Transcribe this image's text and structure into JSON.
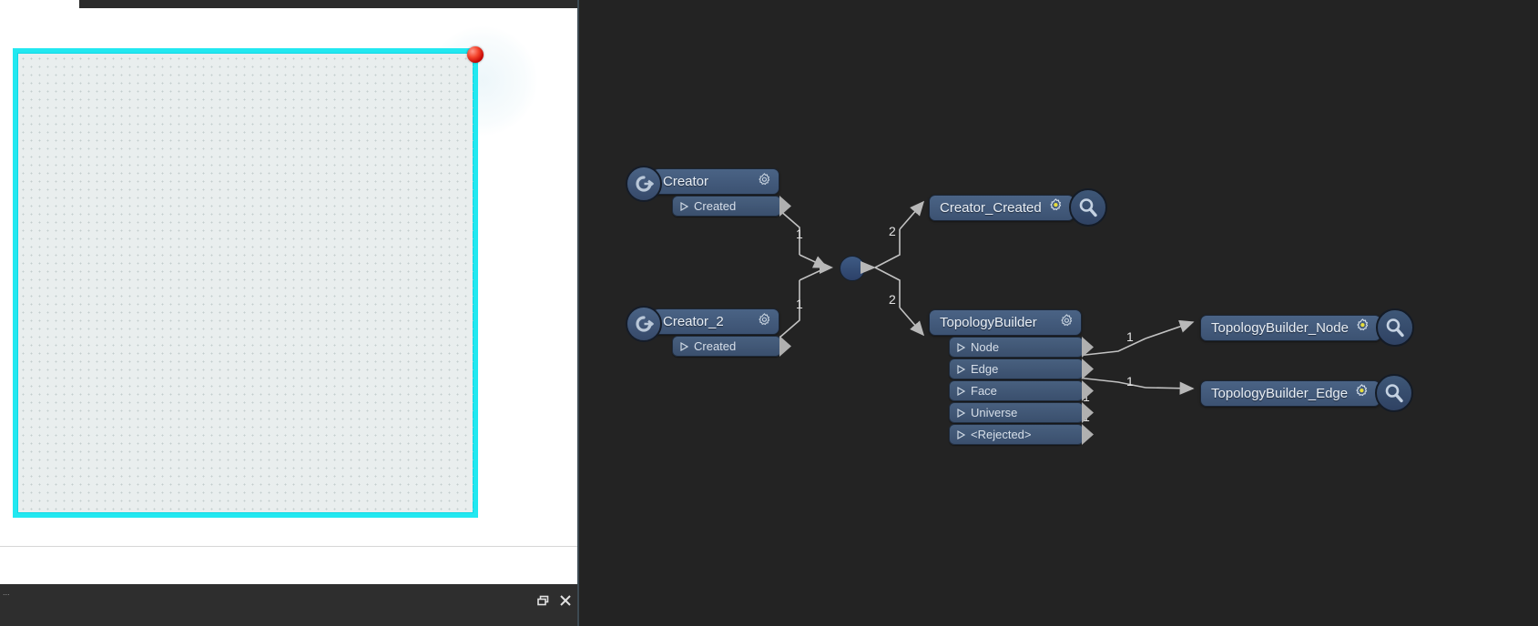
{
  "app": {
    "left_panel": {
      "name": "viewport-panel",
      "canvas_border_color": "#22e8f0",
      "canvas_fill_color": "#e9eeee",
      "marker_color": "#f4442c",
      "bottom_bar": {
        "tip": "...",
        "restore_icon": "restore-window-icon",
        "close_icon": "close-window-icon"
      }
    },
    "graph_panel": {
      "background_color": "#232323",
      "nodes": [
        {
          "id": "creator",
          "title": "Creator",
          "icon": "rotate-arrow-icon",
          "gear": "gear-icon",
          "ports": [
            "Created"
          ]
        },
        {
          "id": "creator_2",
          "title": "Creator_2",
          "icon": "rotate-arrow-icon",
          "gear": "gear-icon",
          "ports": [
            "Created"
          ]
        },
        {
          "id": "topologybuilder",
          "title": "TopologyBuilder",
          "gear": "gear-icon",
          "ports": [
            "Node",
            "Edge",
            "Face",
            "Universe",
            "<Rejected>"
          ]
        }
      ],
      "results": [
        {
          "id": "creator_created",
          "title": "Creator_Created",
          "gear": "gear-icon-active",
          "magnifier": "magnifier-icon"
        },
        {
          "id": "topologybuilder_node",
          "title": "TopologyBuilder_Node",
          "gear": "gear-icon-active",
          "magnifier": "magnifier-icon"
        },
        {
          "id": "topologybuilder_edge",
          "title": "TopologyBuilder_Edge",
          "gear": "gear-icon-active",
          "magnifier": "magnifier-icon"
        }
      ],
      "junction": {
        "id": "merge-junction",
        "color": "#36507b"
      },
      "edge_labels": {
        "creator_to_junction": "1",
        "creator2_to_junction": "1",
        "junction_to_creator_created": "2",
        "junction_to_topologybuilder": "2",
        "node_to_result": "1",
        "edge_to_result": "1",
        "face_count": "1",
        "universe_count": "1"
      }
    }
  }
}
